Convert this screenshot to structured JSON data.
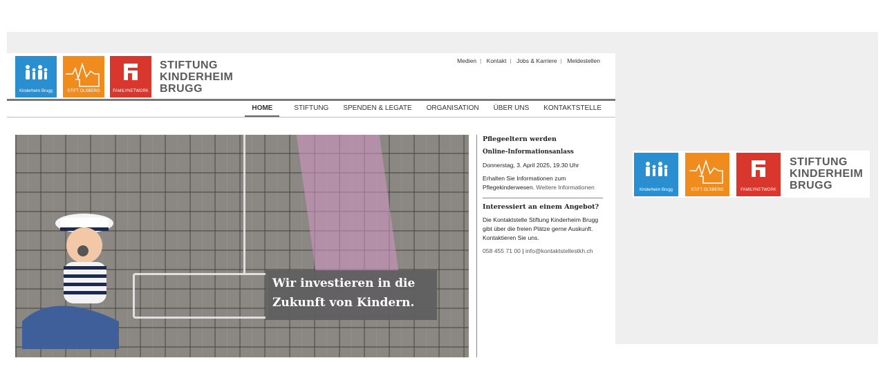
{
  "logos": [
    {
      "name": "kinderheim-brugg",
      "caption": "Kinderheim Brugg",
      "color": "#2a8fd0",
      "icon": "family-icon"
    },
    {
      "name": "stift-olsberg",
      "caption": "STIFT OLSBERG",
      "color": "#f08c1e",
      "icon": "skyline-icon"
    },
    {
      "name": "family-network",
      "caption": "FAMILYNETWORK",
      "color": "#d9372e",
      "icon": "f-logo-icon"
    }
  ],
  "brand": {
    "line1": "STIFTUNG",
    "line2": "KINDERHEIM",
    "line3": "BRUGG"
  },
  "topnav": [
    "Medien",
    "Kontakt",
    "Jobs & Karriere",
    "Meldestellen"
  ],
  "mainnav": [
    "HOME",
    "STIFTUNG",
    "SPENDEN & LEGATE",
    "ORGANISATION",
    "ÜBER UNS",
    "KONTAKTSTELLE"
  ],
  "hero": {
    "caption_line1": "Wir investieren in die",
    "caption_line2": "Zukunft von Kindern."
  },
  "sidebar": {
    "h1": "Pflegeeltern werden",
    "h2": "Online-Informationsanlass",
    "date": "Donnerstag, 3. April 2025, 19.30 Uhr",
    "info": "Erhalten Sie Informationen zum Pflegekinderwesen.",
    "info_link": "Weitere Informationen",
    "h3": "Interessiert an einem Angebot?",
    "offer": "Die Kontaktstelle Stiftung Kinderheim Brugg gibt über die freien Plätze gerne Auskunft. Kontaktieren Sie uns.",
    "phone": "058 455 71 00",
    "email": "info@kontaktstellestkh.ch"
  }
}
